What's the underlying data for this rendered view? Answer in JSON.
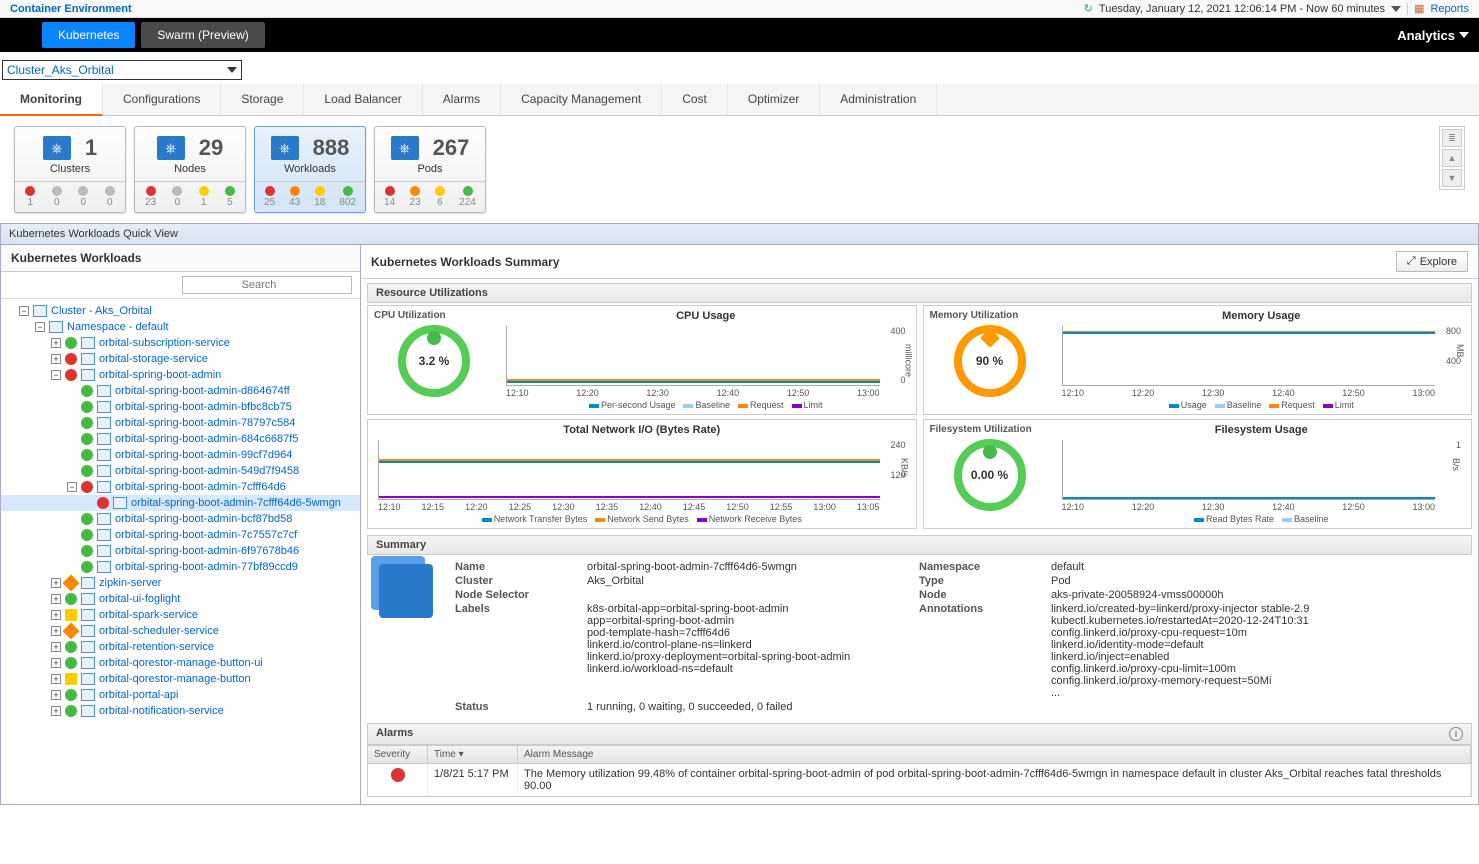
{
  "header": {
    "breadcrumb": "Container Environment",
    "timerange": "Tuesday, January 12, 2021 12:06:14 PM - Now 60 minutes",
    "reports": "Reports"
  },
  "blackbar": {
    "tabs": [
      {
        "label": "Kubernetes",
        "active": true
      },
      {
        "label": "Swarm (Preview)",
        "active": false
      }
    ],
    "right": "Analytics"
  },
  "cluster_select": "Cluster_Aks_Orbital",
  "subtabs": [
    "Monitoring",
    "Configurations",
    "Storage",
    "Load Balancer",
    "Alarms",
    "Capacity Management",
    "Cost",
    "Optimizer",
    "Administration"
  ],
  "active_subtab": "Monitoring",
  "cards": [
    {
      "label": "Clusters",
      "count": "1",
      "footer": [
        {
          "c": "red",
          "v": "1"
        },
        {
          "c": "gray",
          "v": "0"
        },
        {
          "c": "gray",
          "v": "0"
        },
        {
          "c": "gray",
          "v": "0"
        }
      ]
    },
    {
      "label": "Nodes",
      "count": "29",
      "footer": [
        {
          "c": "red",
          "v": "23"
        },
        {
          "c": "gray",
          "v": "0"
        },
        {
          "c": "yellow",
          "v": "1"
        },
        {
          "c": "green",
          "v": "5"
        }
      ]
    },
    {
      "label": "Workloads",
      "count": "888",
      "active": true,
      "footer": [
        {
          "c": "red",
          "v": "25"
        },
        {
          "c": "orange",
          "v": "43"
        },
        {
          "c": "yellow",
          "v": "18"
        },
        {
          "c": "green",
          "v": "802"
        }
      ]
    },
    {
      "label": "Pods",
      "count": "267",
      "footer": [
        {
          "c": "red",
          "v": "14"
        },
        {
          "c": "orange",
          "v": "23"
        },
        {
          "c": "yellow",
          "v": "6"
        },
        {
          "c": "green",
          "v": "224"
        }
      ]
    }
  ],
  "quickview_title": "Kubernetes Workloads Quick View",
  "left_title": "Kubernetes Workloads",
  "search_placeholder": "Search",
  "tree": [
    {
      "d": 1,
      "t": "-",
      "s": "",
      "i": "cluster",
      "l": "Cluster - Aks_Orbital"
    },
    {
      "d": 2,
      "t": "-",
      "s": "",
      "i": "ns",
      "l": "Namespace - default"
    },
    {
      "d": 3,
      "t": "+",
      "s": "green",
      "i": "doc",
      "l": "orbital-subscription-service"
    },
    {
      "d": 3,
      "t": "+",
      "s": "red",
      "i": "doc",
      "l": "orbital-storage-service"
    },
    {
      "d": 3,
      "t": "-",
      "s": "red",
      "i": "doc",
      "l": "orbital-spring-boot-admin"
    },
    {
      "d": 4,
      "t": "",
      "s": "green",
      "i": "doc",
      "l": "orbital-spring-boot-admin-d864674ff"
    },
    {
      "d": 4,
      "t": "",
      "s": "green",
      "i": "doc",
      "l": "orbital-spring-boot-admin-bfbc8cb75"
    },
    {
      "d": 4,
      "t": "",
      "s": "green",
      "i": "doc",
      "l": "orbital-spring-boot-admin-78797c584"
    },
    {
      "d": 4,
      "t": "",
      "s": "green",
      "i": "doc",
      "l": "orbital-spring-boot-admin-684c6687f5"
    },
    {
      "d": 4,
      "t": "",
      "s": "green",
      "i": "doc",
      "l": "orbital-spring-boot-admin-99cf7d964"
    },
    {
      "d": 4,
      "t": "",
      "s": "green",
      "i": "doc",
      "l": "orbital-spring-boot-admin-549d7f9458"
    },
    {
      "d": 4,
      "t": "-",
      "s": "red",
      "i": "doc",
      "l": "orbital-spring-boot-admin-7cfff64d6"
    },
    {
      "d": 5,
      "t": "",
      "s": "red",
      "i": "doc",
      "l": "orbital-spring-boot-admin-7cfff64d6-5wmgn",
      "sel": true
    },
    {
      "d": 4,
      "t": "",
      "s": "green",
      "i": "doc",
      "l": "orbital-spring-boot-admin-bcf87bd58"
    },
    {
      "d": 4,
      "t": "",
      "s": "green",
      "i": "doc",
      "l": "orbital-spring-boot-admin-7c7557c7cf"
    },
    {
      "d": 4,
      "t": "",
      "s": "green",
      "i": "doc",
      "l": "orbital-spring-boot-admin-6f97678b46"
    },
    {
      "d": 4,
      "t": "",
      "s": "green",
      "i": "doc",
      "l": "orbital-spring-boot-admin-77bf89ccd9"
    },
    {
      "d": 3,
      "t": "+",
      "s": "orange",
      "i": "doc",
      "l": "zipkin-server"
    },
    {
      "d": 3,
      "t": "+",
      "s": "green",
      "i": "doc",
      "l": "orbital-ui-foglight"
    },
    {
      "d": 3,
      "t": "+",
      "s": "yellow",
      "i": "doc",
      "l": "orbital-spark-service"
    },
    {
      "d": 3,
      "t": "+",
      "s": "orange",
      "i": "doc",
      "l": "orbital-scheduler-service"
    },
    {
      "d": 3,
      "t": "+",
      "s": "green",
      "i": "doc",
      "l": "orbital-retention-service"
    },
    {
      "d": 3,
      "t": "+",
      "s": "green",
      "i": "doc",
      "l": "orbital-qorestor-manage-button-ui"
    },
    {
      "d": 3,
      "t": "+",
      "s": "yellow",
      "i": "doc",
      "l": "orbital-qorestor-manage-button"
    },
    {
      "d": 3,
      "t": "+",
      "s": "green",
      "i": "doc",
      "l": "orbital-portal-api"
    },
    {
      "d": 3,
      "t": "+",
      "s": "green",
      "i": "doc",
      "l": "orbital-notification-service"
    }
  ],
  "right_title": "Kubernetes Workloads Summary",
  "explore_label": "Explore",
  "sections": {
    "resutil": "Resource Utilizations",
    "summary": "Summary",
    "alarms": "Alarms"
  },
  "gauges": {
    "cpu": {
      "title": "CPU Utilization",
      "value": "3.2 %",
      "color": "green"
    },
    "mem": {
      "title": "Memory Utilization",
      "value": "90 %",
      "color": "orange"
    },
    "fs": {
      "title": "Filesystem Utilization",
      "value": "0.00 %",
      "color": "green"
    }
  },
  "charts": {
    "cpu": {
      "title": "CPU Usage",
      "xticks": [
        "12:10",
        "12:20",
        "12:30",
        "12:40",
        "12:50",
        "13:00"
      ],
      "yticks": [
        "400",
        "0"
      ],
      "yunit": "millicore",
      "legend": [
        "Per-second Usage",
        "Baseline",
        "Request",
        "Limit"
      ]
    },
    "mem": {
      "title": "Memory Usage",
      "xticks": [
        "12:10",
        "12:20",
        "12:30",
        "12:40",
        "12:50",
        "13:00"
      ],
      "yticks": [
        "800",
        "400"
      ],
      "yunit": "MB",
      "legend": [
        "Usage",
        "Baseline",
        "Request",
        "Limit"
      ]
    },
    "net": {
      "title": "Total Network I/O (Bytes Rate)",
      "xticks": [
        "12:10",
        "12:15",
        "12:20",
        "12:25",
        "12:30",
        "12:35",
        "12:40",
        "12:45",
        "12:50",
        "12:55",
        "13:00",
        "13:05"
      ],
      "yticks": [
        "240",
        "120"
      ],
      "yunit": "KB/s",
      "legend": [
        "Network Transfer Bytes",
        "Network Send Bytes",
        "Network Receive Bytes"
      ]
    },
    "fs": {
      "title": "Filesystem Usage",
      "xticks": [
        "12:10",
        "12:20",
        "12:30",
        "12:40",
        "12:50",
        "13:00"
      ],
      "yticks": [
        "1"
      ],
      "yunit": "B/s",
      "legend": [
        "Read Bytes Rate",
        "Baseline"
      ]
    }
  },
  "chart_data": [
    {
      "type": "line",
      "title": "CPU Usage",
      "x": [
        "12:10",
        "12:20",
        "12:30",
        "12:40",
        "12:50",
        "13:00"
      ],
      "series": [
        {
          "name": "Per-second Usage",
          "values": [
            12,
            12,
            12,
            12,
            12,
            12
          ]
        },
        {
          "name": "Request",
          "values": [
            20,
            20,
            20,
            20,
            20,
            20
          ]
        }
      ],
      "ylim": [
        0,
        400
      ],
      "ylabel": "millicore"
    },
    {
      "type": "line",
      "title": "Memory Usage",
      "x": [
        "12:10",
        "12:20",
        "12:30",
        "12:40",
        "12:50",
        "13:00"
      ],
      "series": [
        {
          "name": "Usage",
          "values": [
            720,
            720,
            720,
            720,
            720,
            720
          ]
        },
        {
          "name": "Request",
          "values": [
            740,
            740,
            740,
            740,
            740,
            740
          ]
        }
      ],
      "ylim": [
        0,
        800
      ],
      "ylabel": "MB"
    },
    {
      "type": "line",
      "title": "Total Network I/O (Bytes Rate)",
      "x": [
        "12:10",
        "12:15",
        "12:20",
        "12:25",
        "12:30",
        "12:35",
        "12:40",
        "12:45",
        "12:50",
        "12:55",
        "13:00",
        "13:05"
      ],
      "series": [
        {
          "name": "Network Transfer Bytes",
          "values": [
            160,
            160,
            162,
            162,
            160,
            161,
            161,
            160,
            162,
            160,
            161,
            160
          ]
        },
        {
          "name": "Network Send Bytes",
          "values": [
            155,
            155,
            156,
            156,
            155,
            155,
            156,
            155,
            156,
            155,
            156,
            155
          ]
        },
        {
          "name": "Network Receive Bytes",
          "values": [
            5,
            5,
            6,
            6,
            5,
            6,
            5,
            5,
            6,
            5,
            5,
            5
          ]
        }
      ],
      "ylim": [
        0,
        240
      ],
      "ylabel": "KB/s"
    },
    {
      "type": "line",
      "title": "Filesystem Usage",
      "x": [
        "12:10",
        "12:20",
        "12:30",
        "12:40",
        "12:50",
        "13:00"
      ],
      "series": [
        {
          "name": "Read Bytes Rate",
          "values": [
            0,
            0,
            0,
            0,
            0,
            0
          ]
        }
      ],
      "ylim": [
        0,
        1
      ],
      "ylabel": "B/s"
    }
  ],
  "summary": {
    "name_k": "Name",
    "name_v": "orbital-spring-boot-admin-7cfff64d6-5wmgn",
    "cluster_k": "Cluster",
    "cluster_v": "Aks_Orbital",
    "nodesel_k": "Node Selector",
    "nodesel_v": "",
    "labels_k": "Labels",
    "labels_v": "k8s-orbital-app=orbital-spring-boot-admin\napp=orbital-spring-boot-admin\npod-template-hash=7cfff64d6\nlinkerd.io/control-plane-ns=linkerd\nlinkerd.io/proxy-deployment=orbital-spring-boot-admin\nlinkerd.io/workload-ns=default",
    "ns_k": "Namespace",
    "ns_v": "default",
    "type_k": "Type",
    "type_v": "Pod",
    "node_k": "Node",
    "node_v": "aks-private-20058924-vmss00000h",
    "ann_k": "Annotations",
    "ann_v": "linkerd.io/created-by=linkerd/proxy-injector stable-2.9\nkubectl.kubernetes.io/restartedAt=2020-12-24T10:31\nconfig.linkerd.io/proxy-cpu-request=10m\nlinkerd.io/identity-mode=default\nlinkerd.io/inject=enabled\nconfig.linkerd.io/proxy-cpu-limit=100m\nconfig.linkerd.io/proxy-memory-request=50Mi\n...",
    "status_k": "Status",
    "status_v": "1 running, 0 waiting, 0 succeeded, 0 failed"
  },
  "alarms": {
    "cols": [
      "Severity",
      "Time ▾",
      "Alarm Message"
    ],
    "rows": [
      {
        "sev": "red",
        "time": "1/8/21 5:17 PM",
        "msg": "The Memory utilization 99.48% of container orbital-spring-boot-admin of pod orbital-spring-boot-admin-7cfff64d6-5wmgn in namespace default in cluster Aks_Orbital reaches fatal thresholds 90.00"
      }
    ]
  }
}
